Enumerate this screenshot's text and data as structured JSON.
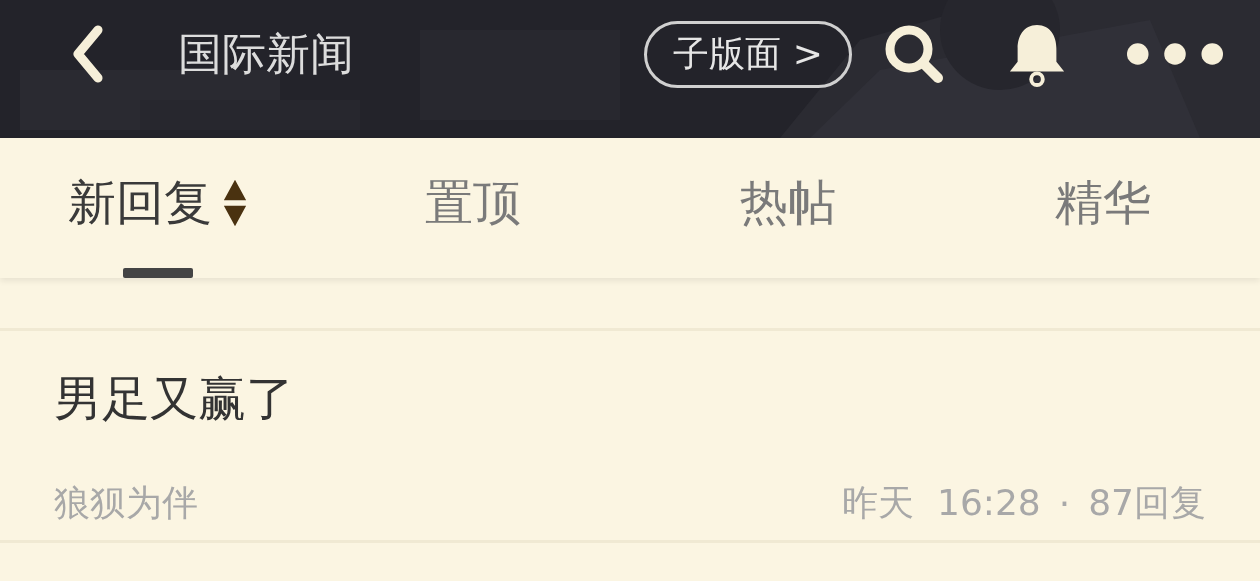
{
  "header": {
    "title": "国际新闻",
    "subforum_button": "子版面 >"
  },
  "tabs": [
    {
      "label": "新回复",
      "selected": true,
      "sortable": true
    },
    {
      "label": "置顶",
      "selected": false,
      "sortable": false
    },
    {
      "label": "热帖",
      "selected": false,
      "sortable": false
    },
    {
      "label": "精华",
      "selected": false,
      "sortable": false
    }
  ],
  "posts": [
    {
      "title": "男足又赢了",
      "author": "狼狈为伴",
      "time": "昨天  16:28",
      "separator": "·",
      "replies": "87回复"
    }
  ]
}
